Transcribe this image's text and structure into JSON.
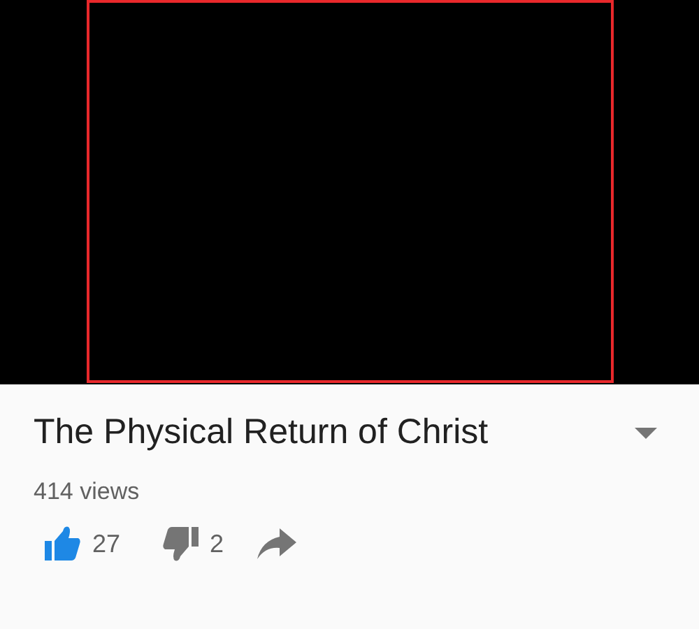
{
  "video": {
    "highlighted": true
  },
  "title": "The Physical Return of Christ",
  "views": "414 views",
  "actions": [
    {
      "kind": "like",
      "count": "27",
      "selected": true
    },
    {
      "kind": "dislike",
      "count": "2",
      "selected": false
    },
    {
      "kind": "share"
    }
  ]
}
